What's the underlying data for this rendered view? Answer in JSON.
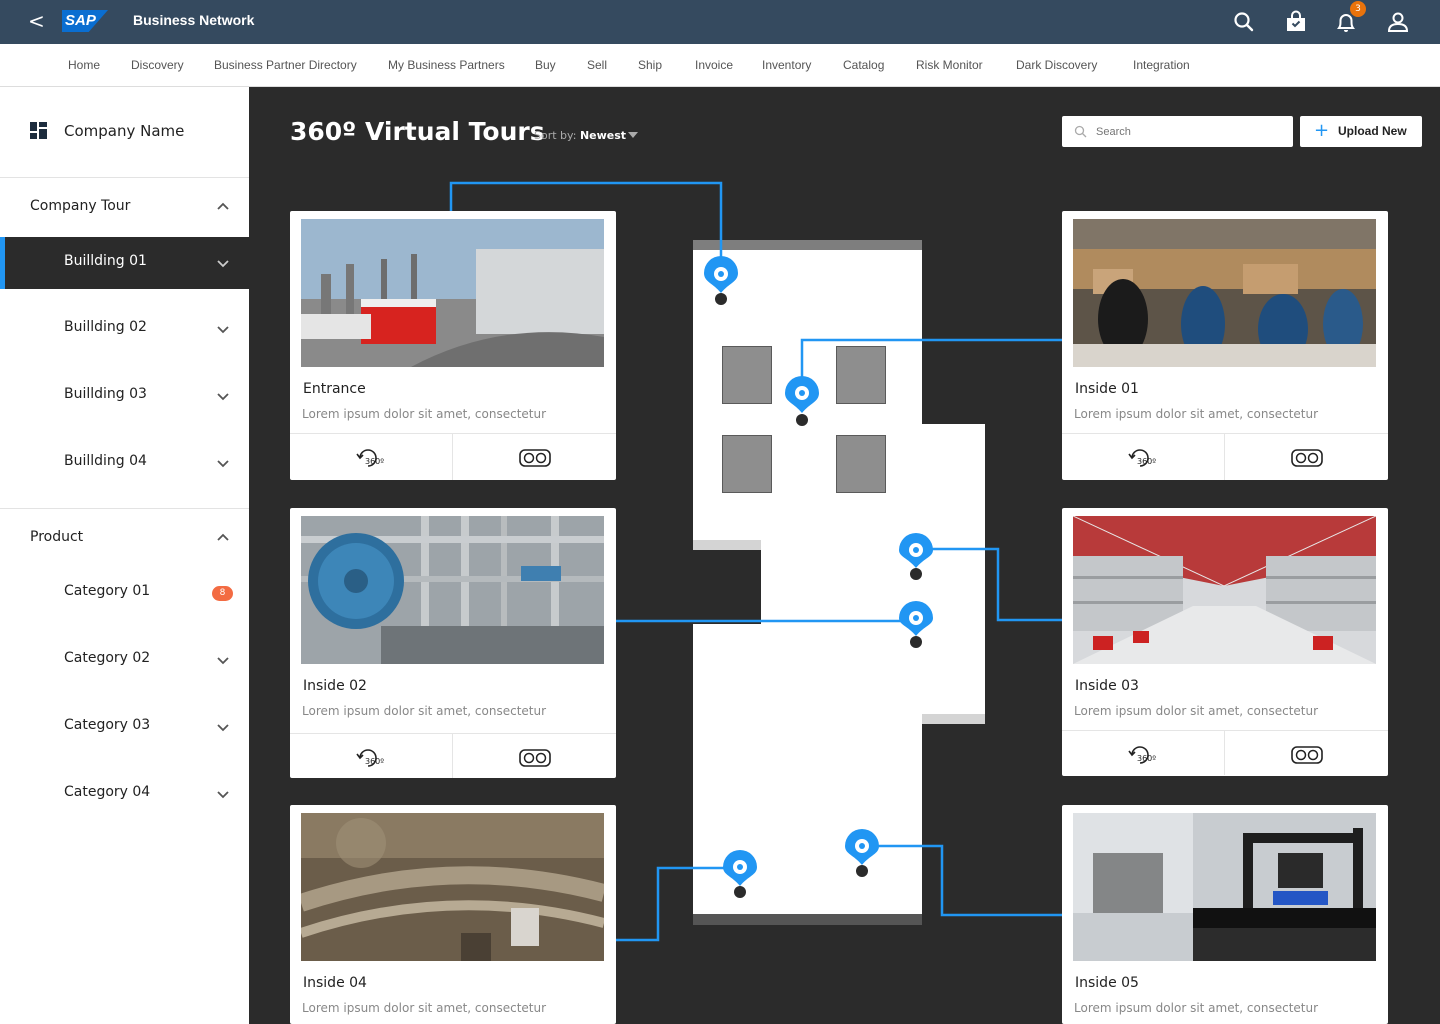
{
  "app": {
    "back_icon": "<",
    "logo": "SAP",
    "title": "Business Network",
    "notification_count": "3",
    "icons": [
      "search-icon",
      "shopping-bag-icon",
      "bell-icon",
      "user-icon"
    ]
  },
  "nav": {
    "items": [
      "Home",
      "Discovery",
      "Business Partner Directory",
      "My Business Partners",
      "Buy",
      "Sell",
      "Ship",
      "Invoice",
      "Inventory",
      "Catalog",
      "Risk Monitor",
      "Dark Discovery",
      "Integration"
    ]
  },
  "sidebar": {
    "company_name": "Company Name",
    "company_tour": {
      "title": "Company Tour",
      "items": [
        "Buillding 01",
        "Buillding 02",
        "Buillding 03",
        "Buillding 04"
      ],
      "active": "Buillding 01"
    },
    "product": {
      "title": "Product",
      "items": [
        "Category 01",
        "Category 02",
        "Category 03",
        "Category 04"
      ],
      "badge": "8"
    }
  },
  "main": {
    "title": "360º Virtual Tours",
    "sort_label": "Sort by:",
    "sort_value": "Newest",
    "search_placeholder": "Search",
    "upload_label": "Upload New",
    "upload_icon": "+"
  },
  "cards": [
    {
      "title": "Entrance",
      "desc": "Lorem ipsum dolor sit amet, consectetur",
      "icons": [
        "360-rotate-icon",
        "vr-headset-icon"
      ]
    },
    {
      "title": "Inside 01",
      "desc": "Lorem ipsum dolor sit amet, consectetur",
      "icons": [
        "360-rotate-icon",
        "vr-headset-icon"
      ]
    },
    {
      "title": "Inside 02",
      "desc": "Lorem ipsum dolor sit amet, consectetur",
      "icons": [
        "360-rotate-icon",
        "vr-headset-icon"
      ]
    },
    {
      "title": "Inside 03",
      "desc": "Lorem ipsum dolor sit amet, consectetur",
      "icons": [
        "360-rotate-icon",
        "vr-headset-icon"
      ]
    },
    {
      "title": "Inside 04",
      "desc": "Lorem ipsum dolor sit amet, consectetur",
      "icons": []
    },
    {
      "title": "Inside 05",
      "desc": "Lorem ipsum dolor sit amet, consectetur",
      "icons": []
    }
  ],
  "icon_text": {
    "rotate": "360º"
  },
  "colors": {
    "accent": "#2196f3",
    "topbar": "#354a5f",
    "background": "#2b2b2b",
    "badge": "#f36b42"
  }
}
